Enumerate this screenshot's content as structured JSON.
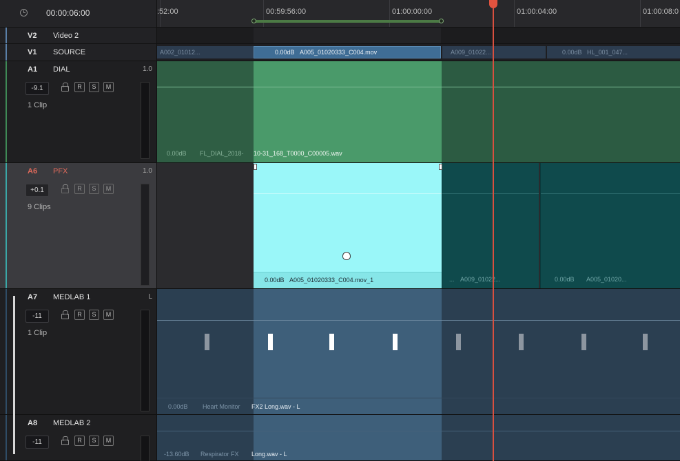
{
  "header": {
    "timecode": "00:00:06:00",
    "ruler_labels": [
      ":52:00",
      "00:59:56:00",
      "01:00:00:00",
      "01:00:04:00",
      "01:00:08:0"
    ]
  },
  "tracks": {
    "v2": {
      "id": "V2",
      "name": "Video 2"
    },
    "v1": {
      "id": "V1",
      "name": "SOURCE"
    },
    "a1": {
      "id": "A1",
      "name": "DIAL",
      "level": "1.0",
      "volume": "-9.1",
      "clips": "1 Clip"
    },
    "a6": {
      "id": "A6",
      "name": "PFX",
      "level": "1.0",
      "volume": "+0.1",
      "clips": "9 Clips"
    },
    "a7": {
      "id": "A7",
      "name": "MEDLAB 1",
      "level": "L",
      "volume": "-11",
      "clips": "1 Clip"
    },
    "a8": {
      "id": "A8",
      "name": "MEDLAB 2",
      "volume": "-11"
    }
  },
  "buttons": {
    "record": "R",
    "solo": "S",
    "mute": "M"
  },
  "clips": {
    "v1_a": "A002_01012...",
    "v1_b_gain": "0.00dB",
    "v1_b_name": "A005_01020333_C004.mov",
    "v1_c": "A009_01022...",
    "v1_d_gain": "0.00dB",
    "v1_d_name": "HL_001_047...",
    "a1_gain": "0.00dB",
    "a1_name_dim": "FL_DIAL_2018-",
    "a1_name": "10-31_168_T0000_C00005.wav",
    "a6_gain": "0.00dB",
    "a6_name": "A005_01020333_C004.mov_1",
    "a6_b": "A009_01022...",
    "a6_c_gain": "0.00dB",
    "a6_c_name": "A005_01020...",
    "a6_dots": "...",
    "a7_gain": "0.00dB",
    "a7_name_dim": "Heart Monitor",
    "a7_name": "FX2 Long.wav - L",
    "a8_gain": "-13.60dB",
    "a8_name_dim": "Respirator FX",
    "a8_name": "Long.wav - L"
  },
  "colors": {
    "playhead": "#e2533f",
    "dial_green": "#4a9a6a",
    "pfx_cyan": "#9af7f9",
    "medlab_blue": "#3e5f7a",
    "source_blue": "#3f6d95"
  }
}
